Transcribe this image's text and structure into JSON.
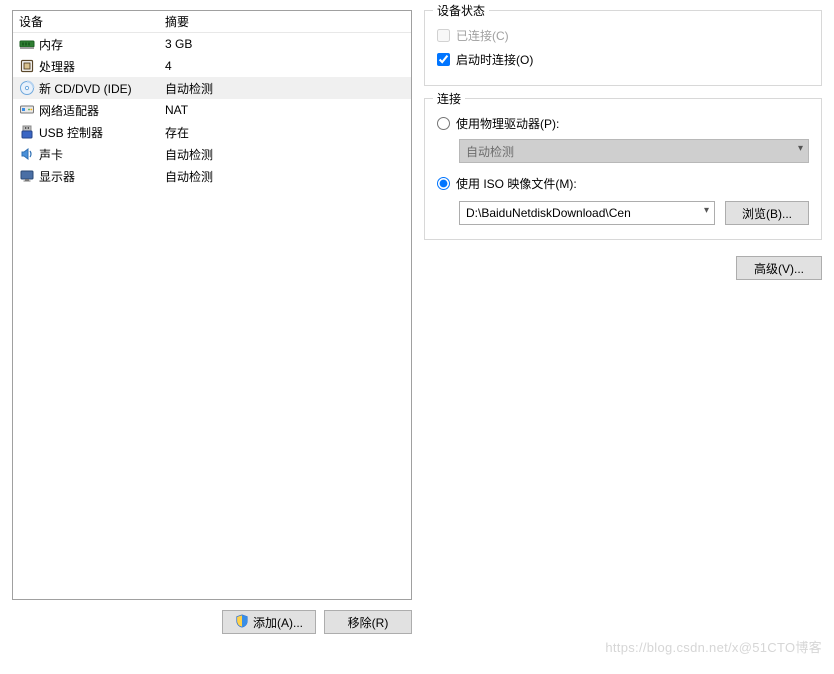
{
  "left": {
    "header_device": "设备",
    "header_summary": "摘要",
    "rows": [
      {
        "icon": "memory-icon",
        "name": "内存",
        "summary": "3 GB",
        "selected": false
      },
      {
        "icon": "cpu-icon",
        "name": "处理器",
        "summary": "4",
        "selected": false
      },
      {
        "icon": "cd-icon",
        "name": "新 CD/DVD (IDE)",
        "summary": "自动检测",
        "selected": true
      },
      {
        "icon": "network-icon",
        "name": "网络适配器",
        "summary": "NAT",
        "selected": false
      },
      {
        "icon": "usb-icon",
        "name": "USB 控制器",
        "summary": "存在",
        "selected": false
      },
      {
        "icon": "sound-icon",
        "name": "声卡",
        "summary": "自动检测",
        "selected": false
      },
      {
        "icon": "display-icon",
        "name": "显示器",
        "summary": "自动检测",
        "selected": false
      }
    ],
    "add_label": "添加(A)...",
    "remove_label": "移除(R)"
  },
  "right": {
    "status_legend": "设备状态",
    "connected_label": "已连接(C)",
    "connect_on_power_label": "启动时连接(O)",
    "connect_on_power_checked": true,
    "conn_legend": "连接",
    "use_physical_label": "使用物理驱动器(P):",
    "physical_combo_value": "自动检测",
    "use_iso_label": "使用 ISO 映像文件(M):",
    "iso_path_value": "D:\\BaiduNetdiskDownload\\Cen",
    "browse_label": "浏览(B)...",
    "advanced_label": "高级(V)...",
    "conn_mode": "iso"
  },
  "watermark": "https://blog.csdn.net/x@51CTO博客"
}
